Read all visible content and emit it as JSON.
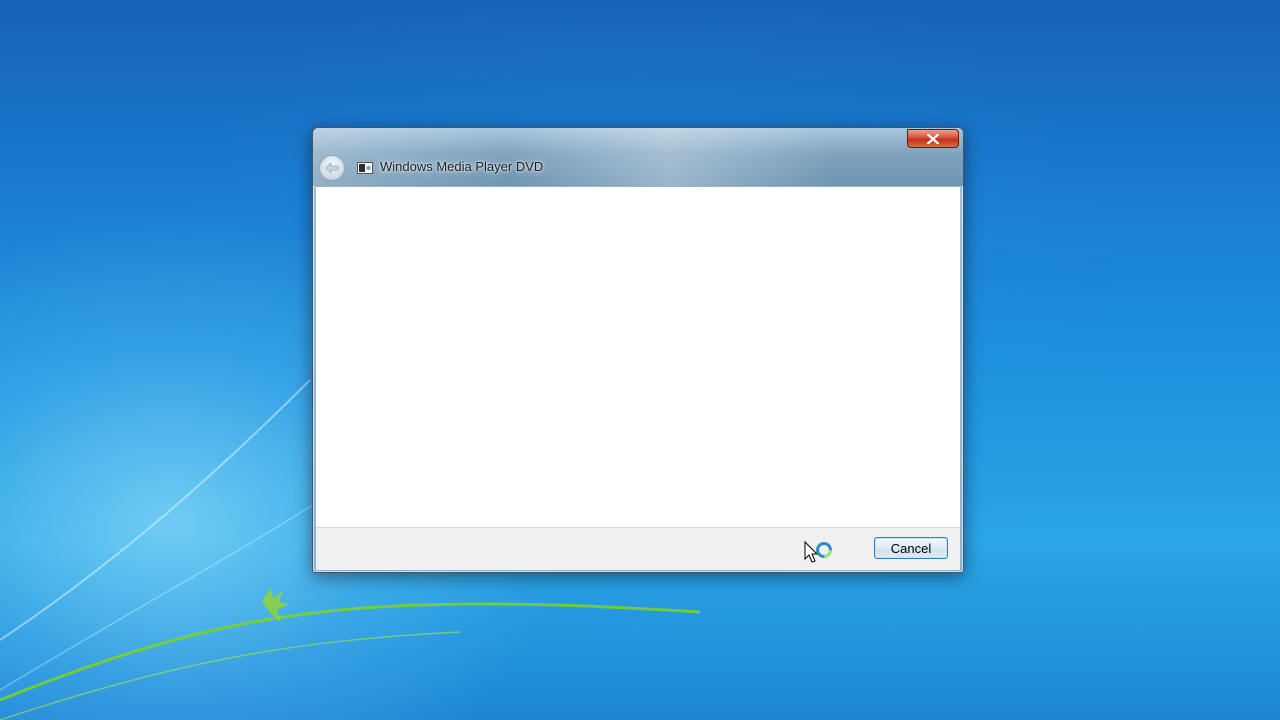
{
  "window": {
    "title": "Windows Media Player DVD",
    "close_icon": "close-icon",
    "back_icon": "back-arrow-icon",
    "app_icon": "media-player-icon"
  },
  "footer": {
    "cancel_label": "Cancel"
  },
  "cursor": {
    "state": "busy-pointer",
    "icon": "busy-cursor-icon"
  },
  "colors": {
    "desktop_blue": "#1f95e0",
    "close_red": "#c0321a",
    "title_glass": "#7fa3be",
    "button_border": "#3c7fb1"
  }
}
